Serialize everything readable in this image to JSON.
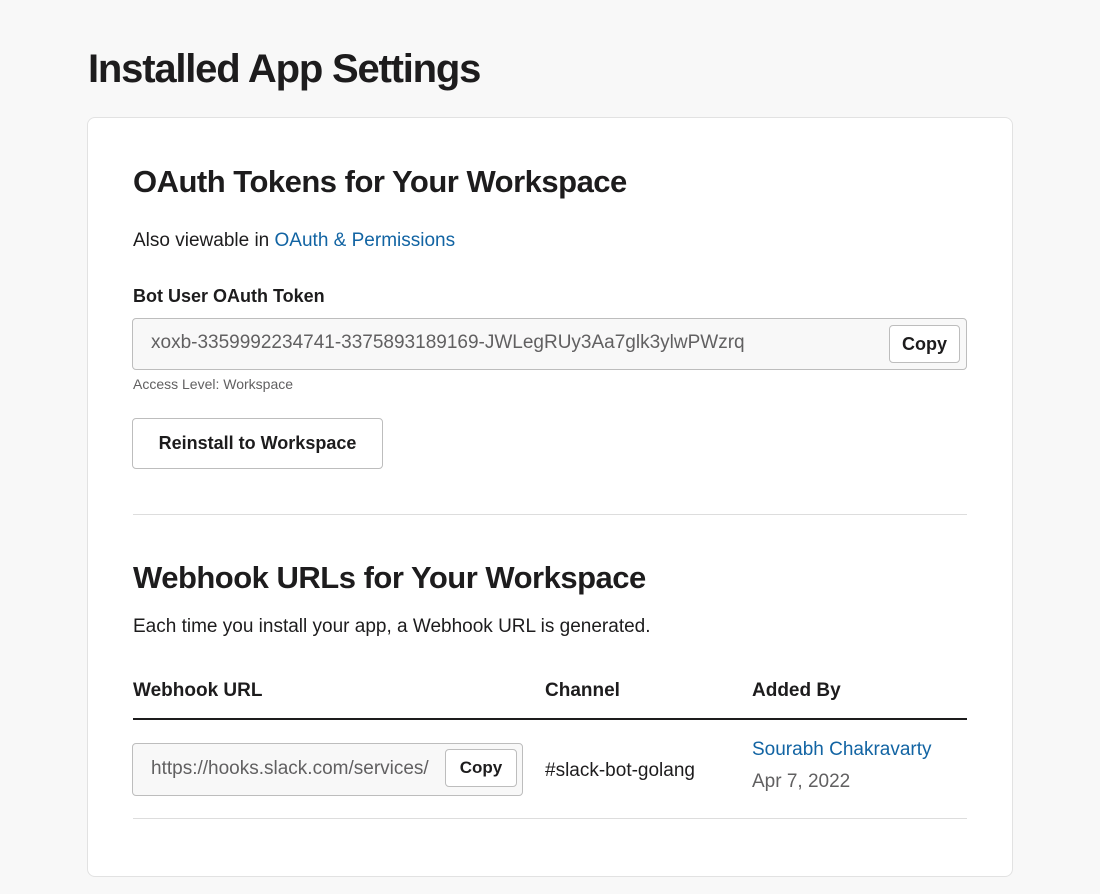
{
  "page": {
    "title": "Installed App Settings"
  },
  "oauth": {
    "title": "OAuth Tokens for Your Workspace",
    "also_viewable_prefix": "Also viewable in ",
    "also_viewable_link": "OAuth & Permissions",
    "bot_token_label": "Bot User OAuth Token",
    "bot_token_value": "xoxb-3359992234741-3375893189169-JWLegRUy3Aa7glk3ylwPWzrq",
    "copy_label": "Copy",
    "access_level": "Access Level: Workspace",
    "reinstall_label": "Reinstall to Workspace"
  },
  "webhooks": {
    "title": "Webhook URLs for Your Workspace",
    "description": "Each time you install your app, a Webhook URL is generated.",
    "columns": [
      "Webhook URL",
      "Channel",
      "Added By"
    ],
    "rows": [
      {
        "url": "https://hooks.slack.com/services/",
        "copy_label": "Copy",
        "channel": "#slack-bot-golang",
        "added_by": "Sourabh Chakravarty",
        "date": "Apr 7, 2022"
      }
    ]
  },
  "colors": {
    "link": "#1264a3",
    "text": "#1d1c1d",
    "muted": "#616061",
    "background": "#f8f8f8"
  }
}
